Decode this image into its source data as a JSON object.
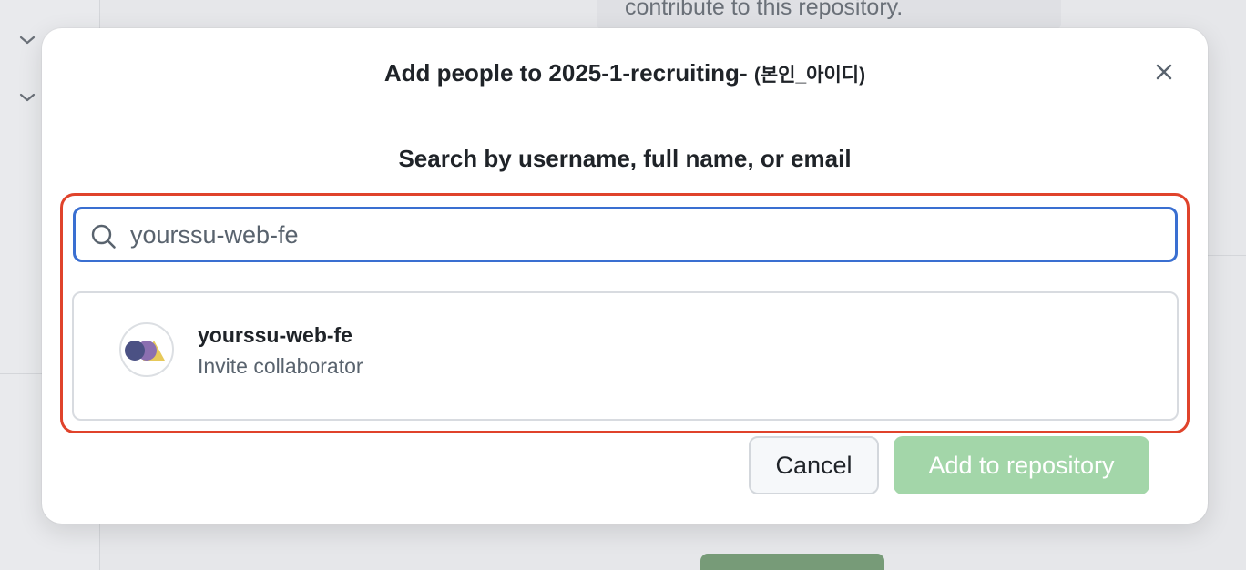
{
  "background": {
    "text": "contribute to this repository."
  },
  "dialog": {
    "title": "Add people to 2025-1-recruiting-",
    "title_suffix": "(본인_아이디)",
    "close_icon": "close-icon",
    "search_heading": "Search by username, full name, or email",
    "search": {
      "icon": "search-icon",
      "value": "yourssu-web-fe"
    },
    "results": [
      {
        "name": "yourssu-web-fe",
        "subtitle": "Invite collaborator",
        "avatar": "org-avatar"
      }
    ],
    "buttons": {
      "cancel": "Cancel",
      "add": "Add to repository"
    }
  },
  "colors": {
    "highlight": "#e0432b",
    "focus_border": "#3a6fd1",
    "add_button_disabled": "#a3d6a9"
  }
}
